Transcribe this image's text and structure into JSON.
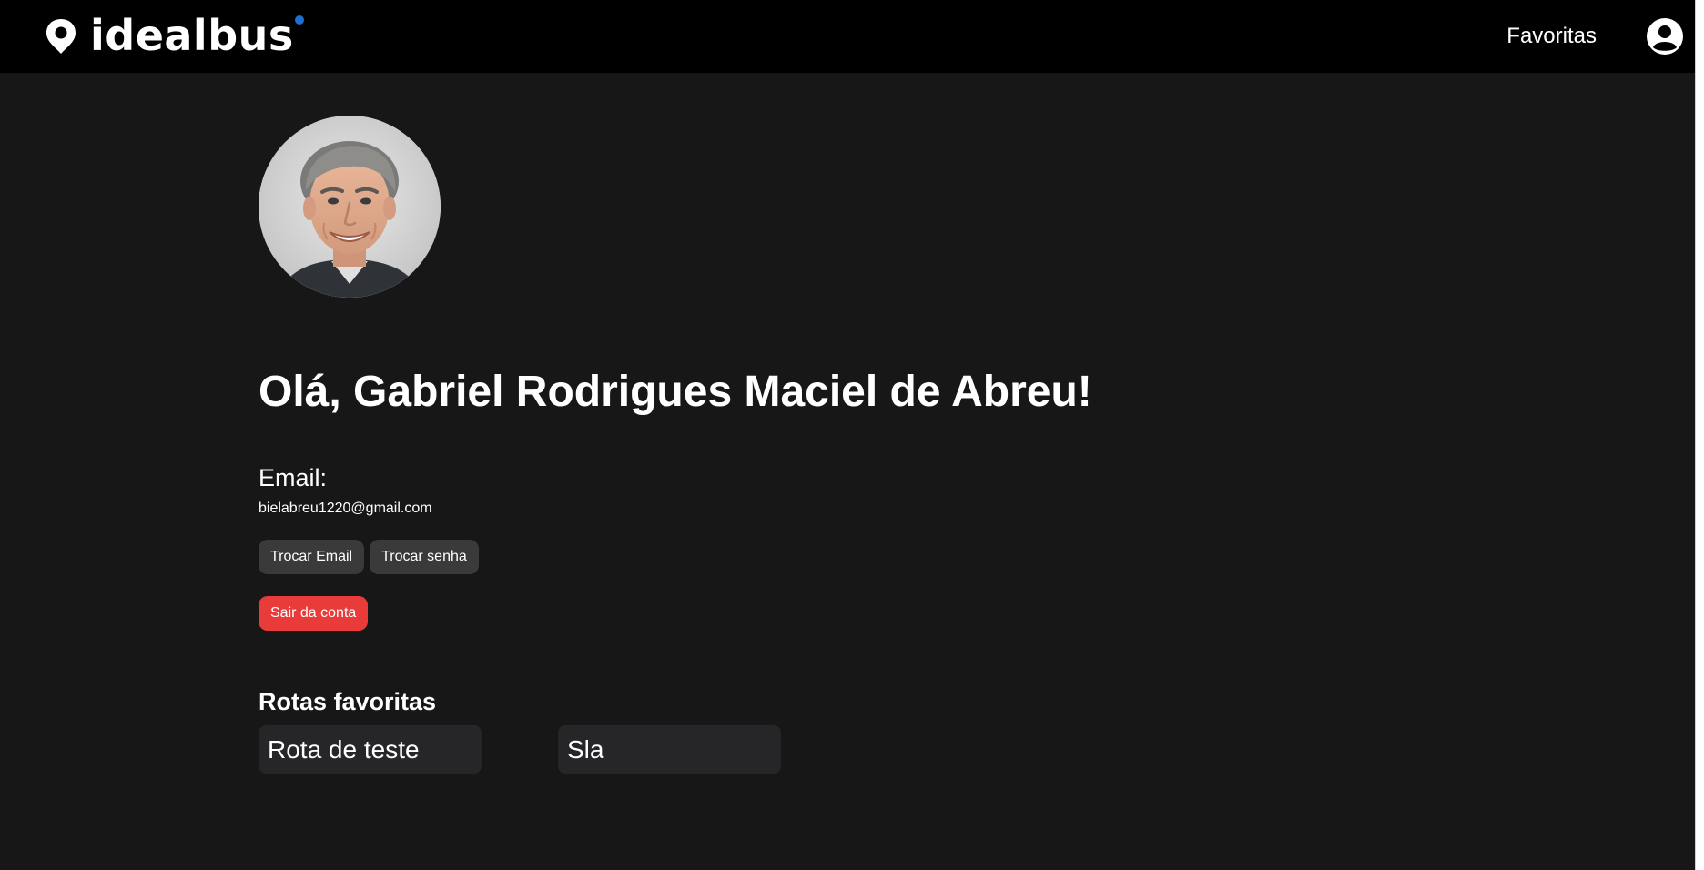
{
  "header": {
    "brand": "idealbus",
    "nav_favorites": "Favoritas",
    "icons": {
      "brand_pin": "location-pin-icon",
      "user": "user-circle-icon"
    }
  },
  "profile": {
    "greeting_prefix": "Olá, ",
    "user_name": "Gabriel Rodrigues Maciel de Abreu",
    "greeting_suffix": "!",
    "email_label": "Email:",
    "email_value": "bielabreu1220@gmail.com",
    "change_email_label": "Trocar Email",
    "change_password_label": "Trocar senha",
    "logout_label": "Sair da conta"
  },
  "favorites": {
    "title": "Rotas favoritas",
    "routes": [
      {
        "name": "Rota de teste"
      },
      {
        "name": "Sla"
      }
    ]
  },
  "colors": {
    "page_background": "#171717",
    "header_background": "#000000",
    "button_background": "#3a3a3a",
    "danger": "#ea3b3b",
    "card_background": "#262628",
    "brand_accent": "#1f6fd1"
  }
}
